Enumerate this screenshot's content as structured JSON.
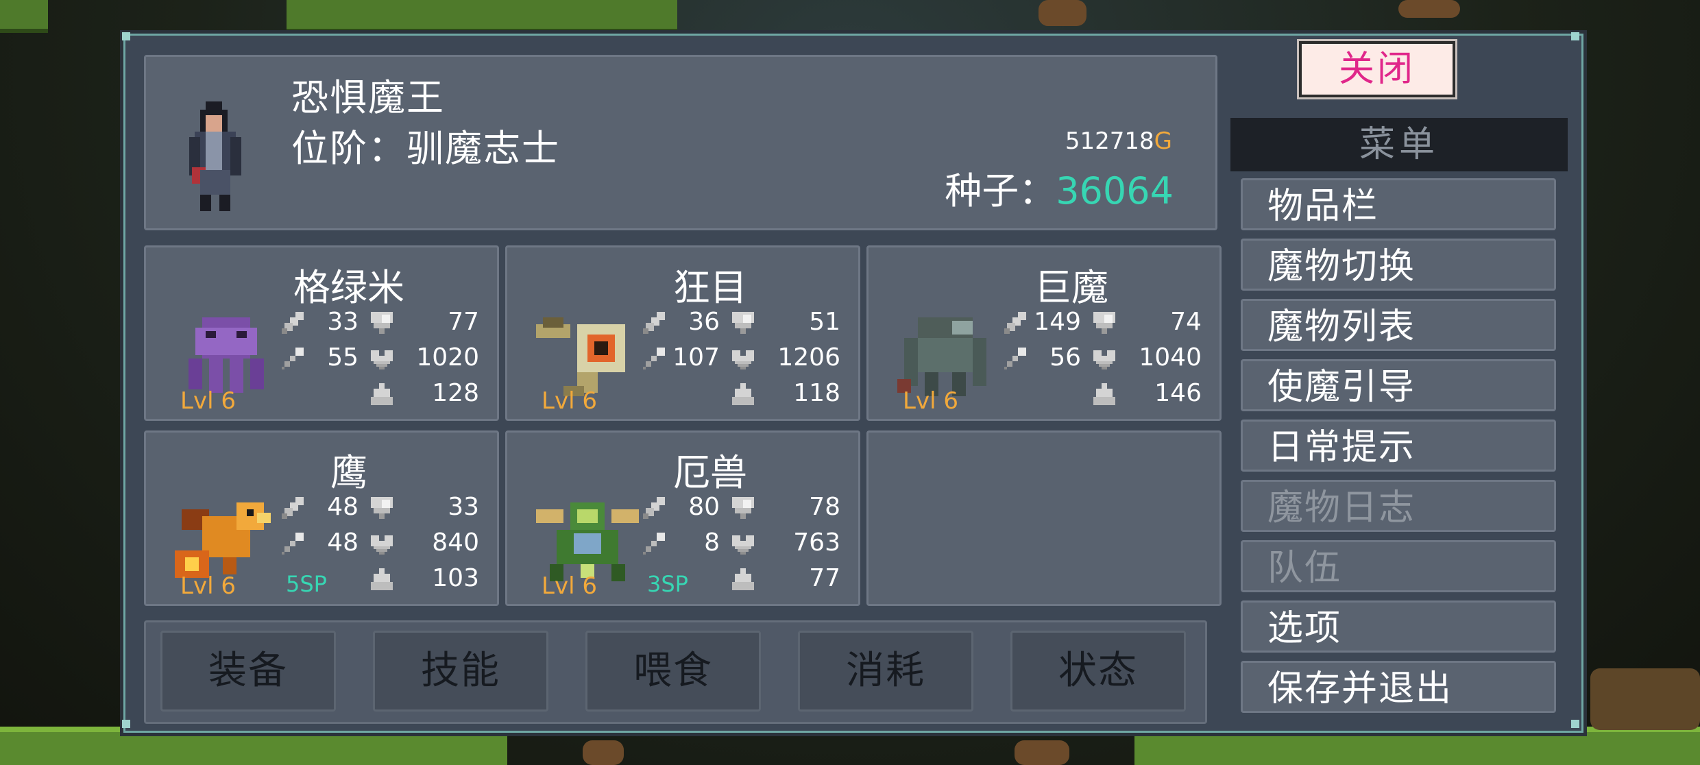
{
  "player": {
    "name": "恐惧魔王",
    "rank": "位阶：驯魔志士",
    "gold_value": "512718",
    "gold_unit": "G",
    "seeds_label": "种子：",
    "seeds_value": "36064"
  },
  "monsters": [
    {
      "name": "格绿米",
      "level": "Lvl 6",
      "atk": "33",
      "def": "77",
      "mag": "55",
      "hp": "1020",
      "wt": "128",
      "sp": ""
    },
    {
      "name": "狂目",
      "level": "Lvl 6",
      "atk": "36",
      "def": "51",
      "mag": "107",
      "hp": "1206",
      "wt": "118",
      "sp": ""
    },
    {
      "name": "巨魔",
      "level": "Lvl 6",
      "atk": "149",
      "def": "74",
      "mag": "56",
      "hp": "1040",
      "wt": "146",
      "sp": ""
    },
    {
      "name": "鹰",
      "level": "Lvl 6",
      "atk": "48",
      "def": "33",
      "mag": "48",
      "hp": "840",
      "wt": "103",
      "sp": "5SP"
    },
    {
      "name": "厄兽",
      "level": "Lvl 6",
      "atk": "80",
      "def": "78",
      "mag": "8",
      "hp": "763",
      "wt": "77",
      "sp": "3SP"
    }
  ],
  "actions": [
    "装备",
    "技能",
    "喂食",
    "消耗",
    "状态"
  ],
  "menu": {
    "close_label": "关闭",
    "title": "菜单",
    "items": [
      "物品栏",
      "魔物切换",
      "魔物列表",
      "使魔引导",
      "日常提示",
      "魔物日志",
      "队伍",
      "选项",
      "保存并退出"
    ],
    "disabled": [
      false,
      false,
      false,
      false,
      false,
      true,
      true,
      false,
      false
    ]
  },
  "colors": {
    "gold": "#f2a93b",
    "teal": "#37d6b3",
    "close_text": "#e0268a",
    "panel": "#5a6370"
  }
}
